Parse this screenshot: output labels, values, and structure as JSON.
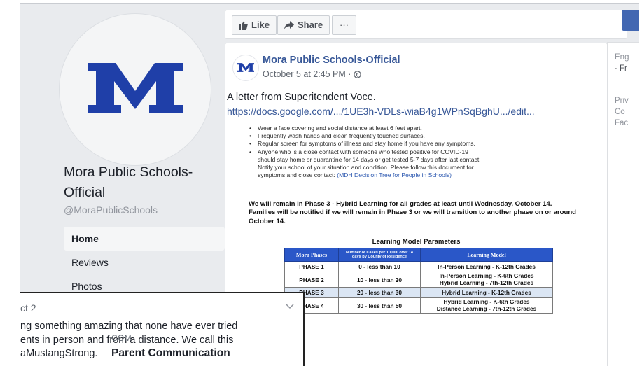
{
  "action_bar": {
    "like_label": "Like",
    "share_label": "Share",
    "more_label": "···"
  },
  "profile": {
    "logo_letter": "M",
    "name": "Mora Public Schools-Official",
    "handle": "@MoraPublicSchools"
  },
  "nav": {
    "items": [
      "Home",
      "Reviews",
      "Photos"
    ]
  },
  "post": {
    "author": "Mora Public Schools-Official",
    "timestamp": "October 5 at 2:45 PM ·",
    "text": "A letter from Superitendent Voce.",
    "link": "https://docs.google.com/.../1UE3h-VDLs-wiaB4g1WPnSqBghU.../edit...",
    "link_domain": "COM",
    "link_title": "Parent Communication"
  },
  "document": {
    "bullets": [
      "Wear a face covering and social distance at least 6 feet apart.",
      "Frequently wash hands and clean frequently touched surfaces.",
      "Regular screen for symptoms of illness and stay home if you have any symptoms.",
      "Anyone who is a close contact with someone who tested positive for COVID-19"
    ],
    "bullet_cont_1": "should stay home or quarantine for 14 days or get tested 5-7 days after last contact.",
    "bullet_cont_2": "Notify your school of your situation and condition. Please follow this document for",
    "bullet_cont_3": "symptoms and close contact:",
    "bullet_link": "(MDH Decision Tree for People in Schools)",
    "phase_statement": "We will remain in Phase 3 - Hybrid Learning for all grades at least until Wednesday, October 14.  Families will be notified if we will remain in Phase 3 or we will transition to another phase on or around October 14.",
    "table_title": "Learning Model Parameters",
    "table_headers": [
      "Mora Phases",
      "Number of Cases per 10,000 over 14 days by County of Residence",
      "Learning Model"
    ],
    "table_rows": [
      {
        "phase": "PHASE 1",
        "cases": "0 - less than 10",
        "model": "In-Person Learning - K-12th Grades",
        "model2": ""
      },
      {
        "phase": "PHASE 2",
        "cases": "10 - less than 20",
        "model": "In-Person Learning - K-6th Grades",
        "model2": "Hybrid Learning - 7th-12th Grades"
      },
      {
        "phase": "PHASE 3",
        "cases": "20 - less than 30",
        "model": "Hybrid Learning - K-12th Grades",
        "model2": ""
      },
      {
        "phase": "PHASE 4",
        "cases": "30 - less than 50",
        "model": "Hybrid Learning - K-6th Grades",
        "model2": "Distance Learning - 7th-12th Grades"
      }
    ]
  },
  "right_column": {
    "line1": "Eng",
    "line2": "· Fr",
    "line3": "Priv",
    "line4": "Co",
    "line5": "Fac"
  },
  "overlay": {
    "title": "ct 2",
    "line1": "ng something amazing that none have ever tried",
    "line2": "ents in person and from a distance.  We call this",
    "line3": "aMustangStrong."
  },
  "colors": {
    "facebook_blue": "#4267b2",
    "link_blue": "#385898",
    "logo_blue": "#1f3fa8",
    "table_header_blue": "#2a57c8"
  }
}
